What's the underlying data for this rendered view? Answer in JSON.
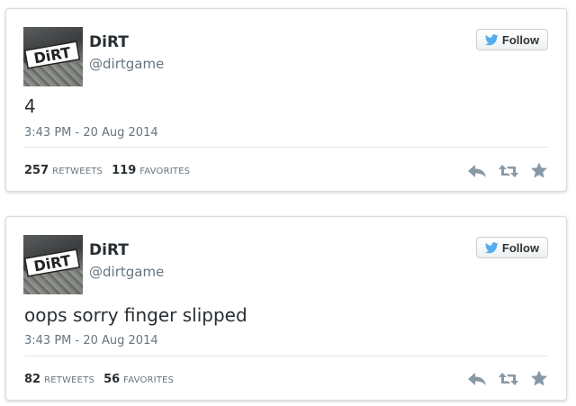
{
  "tweets": [
    {
      "avatar_text": "DiRT",
      "display_name": "DiRT",
      "handle": "@dirtgame",
      "follow_label": "Follow",
      "text": "4",
      "timestamp": "3:43 PM - 20 Aug 2014",
      "retweets_count": "257",
      "retweets_label": "RETWEETS",
      "favorites_count": "119",
      "favorites_label": "FAVORITES"
    },
    {
      "avatar_text": "DiRT",
      "display_name": "DiRT",
      "handle": "@dirtgame",
      "follow_label": "Follow",
      "text": "oops sorry finger slipped",
      "timestamp": "3:43 PM - 20 Aug 2014",
      "retweets_count": "82",
      "retweets_label": "RETWEETS",
      "favorites_count": "56",
      "favorites_label": "FAVORITES"
    }
  ],
  "icons": {
    "follow": "twitter-bird-icon",
    "reply": "reply-icon",
    "retweet": "retweet-icon",
    "favorite": "star-icon"
  },
  "colors": {
    "twitter_blue": "#55acee",
    "action_gray": "#8899a6",
    "text_dark": "#292f33",
    "text_muted": "#66757f"
  }
}
